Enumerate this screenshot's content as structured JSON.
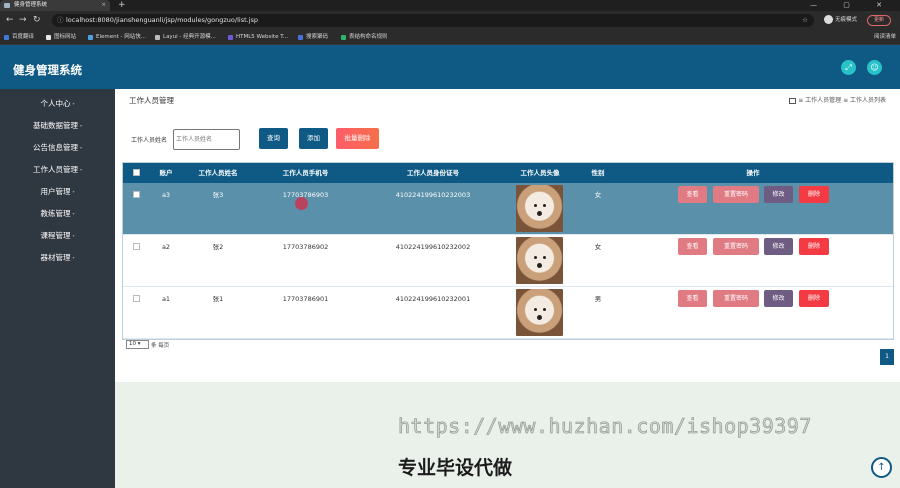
{
  "browser": {
    "tab_title": "健身管理系统",
    "new_tab": "+",
    "window_controls": "— ▢ ✕",
    "url": "localhost:8080/jianshenguanli/jsp/modules/gongzuo/list.jsp",
    "profile_label": "无痕模式",
    "update_label": "更新",
    "bookmarks": [
      "百度翻译",
      "图标网站",
      "Element - 网站快...",
      "Layui - 经典开源模...",
      "HTML5 Website T...",
      "搜索聚码",
      "表结构命名规则"
    ],
    "bookmarks_right": "阅读清单"
  },
  "app": {
    "title": "健身管理系统"
  },
  "sidebar": {
    "items": [
      "个人中心",
      "基础数据管理",
      "公告信息管理",
      "工作人员管理",
      "用户管理",
      "教练管理",
      "课程管理",
      "器材管理"
    ]
  },
  "page": {
    "title": "工作人员管理",
    "breadcrumb": "工作人员管理 ≡ 工作人员列表"
  },
  "search": {
    "label": "工作人员姓名",
    "placeholder": "工作人员姓名",
    "search_button": "查询",
    "add_button": "添加",
    "batch_delete_button": "批量删除"
  },
  "table": {
    "columns": [
      "账户",
      "工作人员姓名",
      "工作人员手机号",
      "工作人员身份证号",
      "工作人员头像",
      "性别",
      "操作"
    ],
    "rows": [
      {
        "account": "a3",
        "name": "张3",
        "phone": "17703786903",
        "id_card": "410224199610232003",
        "gender": "女"
      },
      {
        "account": "a2",
        "name": "张2",
        "phone": "17703786902",
        "id_card": "410224199610232002",
        "gender": "女"
      },
      {
        "account": "a1",
        "name": "张1",
        "phone": "17703786901",
        "id_card": "410224199610232001",
        "gender": "男"
      }
    ],
    "actions": {
      "view": "查看",
      "reset_password": "重置密码",
      "edit": "修改",
      "delete": "删除"
    }
  },
  "pagination": {
    "page_size": "10",
    "page_size_suffix": "条 每页",
    "current_page": "1"
  },
  "overlay": {
    "watermark": "https://www.huzhan.com/ishop39397",
    "promo": "专业毕设代做"
  },
  "colors": {
    "primary": "#0e5a85",
    "sidebar": "#2f3740",
    "highlight_row": "#5a90a9",
    "danger": "#f43b44"
  }
}
